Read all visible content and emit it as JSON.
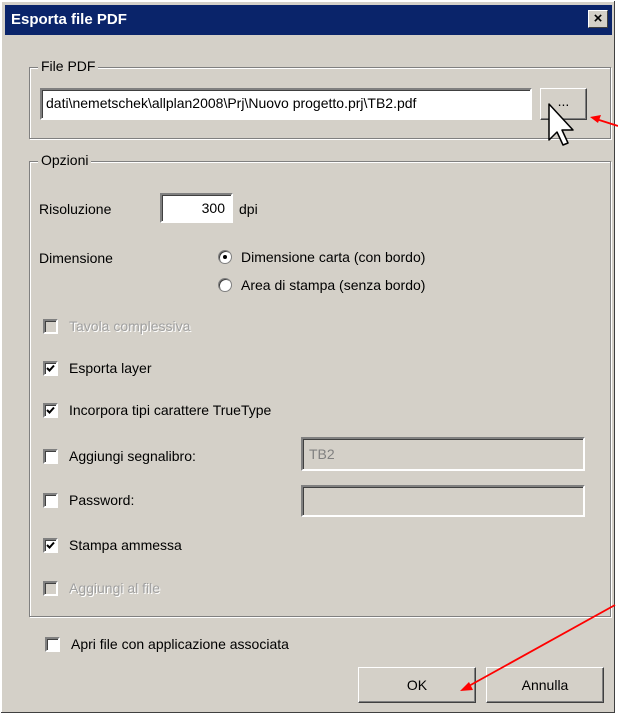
{
  "window": {
    "title": "Esporta file PDF",
    "close_symbol": "×"
  },
  "file_group": {
    "label": "File PDF",
    "path_value": "dati\\nemetschek\\allplan2008\\Prj\\Nuovo progetto.prj\\TB2.pdf",
    "browse_label": "..."
  },
  "options_group": {
    "label": "Opzioni",
    "resolution": {
      "label": "Risoluzione",
      "value": "300",
      "unit": "dpi"
    },
    "dimension": {
      "label": "Dimensione",
      "options": [
        {
          "label": "Dimensione carta (con bordo)",
          "selected": true
        },
        {
          "label": "Area di stampa (senza bordo)",
          "selected": false
        }
      ]
    },
    "checkboxes": [
      {
        "label": "Tavola complessiva",
        "checked": false,
        "enabled": false
      },
      {
        "label": "Esporta layer",
        "checked": true,
        "enabled": true
      },
      {
        "label": "Incorpora tipi carattere TrueType",
        "checked": true,
        "enabled": true
      },
      {
        "label": "Aggiungi segnalibro:",
        "checked": false,
        "enabled": true
      },
      {
        "label": "Password:",
        "checked": false,
        "enabled": true
      },
      {
        "label": "Stampa ammessa",
        "checked": true,
        "enabled": true
      },
      {
        "label": "Aggiungi al file",
        "checked": false,
        "enabled": false
      }
    ],
    "bookmark_value": "TB2",
    "password_value": ""
  },
  "open_with_app": {
    "label": "Apri file con applicazione associata",
    "checked": false
  },
  "buttons": {
    "ok": "OK",
    "cancel": "Annulla"
  },
  "colors": {
    "annotation_arrow": "#ff0000",
    "title_bar": "#0a246a",
    "dialog_bg": "#d4d0c8"
  }
}
